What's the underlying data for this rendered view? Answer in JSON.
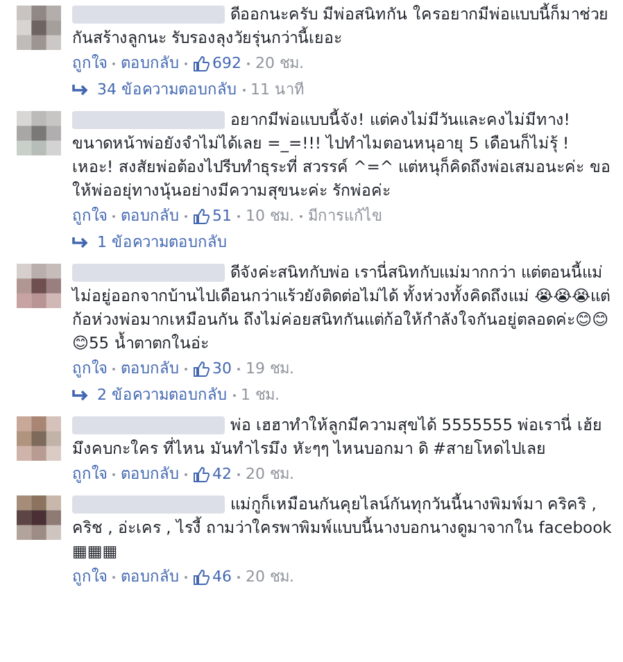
{
  "comments": [
    {
      "text": "ดีออกนะครับ มีพ่อสนิทกัน ใครอยากมีพ่อแบบนี้ก็มาช่วยกันสร้างลูกนะ รับรองลุงวัยรุ่นกว่านี้เยอะ",
      "like_label": "ถูกใจ",
      "reply_label": "ตอบกลับ",
      "likes": "692",
      "time": "20 ชม.",
      "replies": {
        "label": "34 ข้อความตอบกลับ",
        "time": "11 นาที"
      }
    },
    {
      "text": "อยากมีพ่อแบบนี้จัง! แต่คงไม่มีวันและคงไม่มีทาง! ขนาดหน้าพ่อยังจำไม่ได้เลย =_=!!! ไปทำไมตอนหนุอายุ 5 เดือนก็ไม่รุ้ ! เหอะ! สงสัยพ่อต้องไปรีบทำธุระที่ สวรรค์ ^=^ แต่หนุก็คิดถึงพ่อเสมอนะค่ะ ขอให้พ่ออยุ่ทางนุ้นอย่างมีความสุขนะค่ะ รักพ่อค่ะ",
      "like_label": "ถูกใจ",
      "reply_label": "ตอบกลับ",
      "likes": "51",
      "time": "10 ชม.",
      "edited": "มีการแก้ไข",
      "replies": {
        "label": "1 ข้อความตอบกลับ"
      }
    },
    {
      "text": "ดีจังค่ะสนิทกับพ่อ เรานี่สนิทกับแม่มากกว่า แต่ตอนนี้แม่ไม่อยู่ออกจากบ้านไปเดือนกว่าแร้วยังติดต่อไม่ได้ ทั้งห่วงทั้งคิดถึงแม่ 😭😭😭แต่ก้อห่วงพ่อมากเหมือนกัน ถึงไม่ค่อยสนิทกันแต่ก้อให้กำลังใจกันอยู่ตลอดค่ะ😊😊😊55 น้ำตาตกในอ่ะ",
      "like_label": "ถูกใจ",
      "reply_label": "ตอบกลับ",
      "likes": "30",
      "time": "19 ชม.",
      "replies": {
        "label": "2 ข้อความตอบกลับ",
        "time": "1 ชม."
      }
    },
    {
      "text": "พ่อ เฮฮาทำให้ลูกมีความสุขได้ 5555555 พ่อเรานี่ เฮ้ยมึงคบกะใคร ที่ไหน มันทำไรมึง หัะๆๆ ไหนบอกมา ดิ #สายโหดไปเลย",
      "like_label": "ถูกใจ",
      "reply_label": "ตอบกลับ",
      "likes": "42",
      "time": "20 ชม."
    },
    {
      "text": "แม่กูก็เหมือนกันคุยไลน์กันทุกวันนี้นางพิมพ์มา คริคริ , คริช , อ่ะเคร , ไรงี้ ถามว่าใครพาพิมพ์แบบนี้นางบอกนางดูมาจากใน facebook ▦▦▦",
      "like_label": "ถูกใจ",
      "reply_label": "ตอบกลับ",
      "likes": "46",
      "time": "20 ชม."
    }
  ]
}
